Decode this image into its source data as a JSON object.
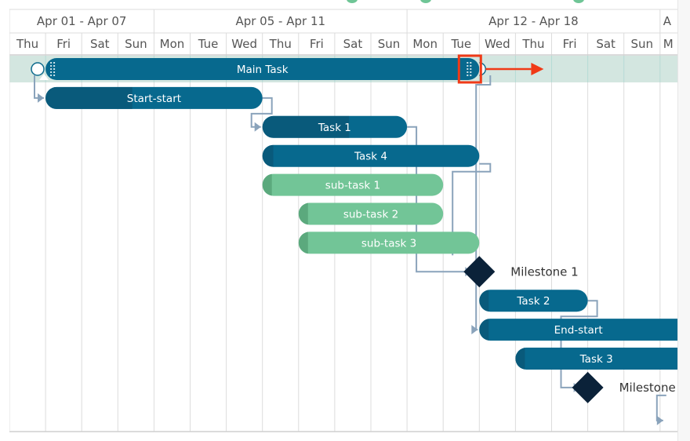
{
  "header": {
    "weeks": [
      "Apr 01 - Apr 07",
      "Apr 05 - Apr 11",
      "Apr 12 - Apr 18",
      "A"
    ],
    "days": [
      "Thu",
      "Fri",
      "Sat",
      "Sun",
      "Mon",
      "Tue",
      "Wed",
      "Thu",
      "Fri",
      "Sat",
      "Sun",
      "Mon",
      "Tue",
      "Wed",
      "Thu",
      "Fri",
      "Sat",
      "Sun",
      "M"
    ]
  },
  "tasks": [
    {
      "id": "main",
      "label": "Main Task",
      "start": 1,
      "end": 13,
      "row": 0,
      "type": "parent",
      "selected": true
    },
    {
      "id": "start-start",
      "label": "Start-start",
      "start": 1,
      "end": 7,
      "row": 1,
      "type": "task",
      "progress": 0.4
    },
    {
      "id": "task1",
      "label": "Task 1",
      "start": 7,
      "end": 11,
      "row": 2,
      "type": "task",
      "progress": 0.6
    },
    {
      "id": "task4",
      "label": "Task 4",
      "start": 7,
      "end": 13,
      "row": 3,
      "type": "task",
      "progress": 0.05
    },
    {
      "id": "subtask1",
      "label": "sub-task 1",
      "start": 7,
      "end": 12,
      "row": 4,
      "type": "subtask",
      "progress": 0.05
    },
    {
      "id": "subtask2",
      "label": "sub-task 2",
      "start": 8,
      "end": 12,
      "row": 5,
      "type": "subtask",
      "progress": 0.05
    },
    {
      "id": "subtask3",
      "label": "sub-task 3",
      "start": 8,
      "end": 13,
      "row": 6,
      "type": "subtask",
      "progress": 0.05
    },
    {
      "id": "milestone1",
      "label": "Milestone 1",
      "at": 13,
      "row": 7,
      "type": "milestone"
    },
    {
      "id": "task2",
      "label": "Task 2",
      "start": 13,
      "end": 16,
      "row": 8,
      "type": "task",
      "progress": 0.05
    },
    {
      "id": "end-start",
      "label": "End-start",
      "start": 13,
      "end": 19,
      "row": 9,
      "type": "task",
      "progress": 0.03
    },
    {
      "id": "task3",
      "label": "Task 3",
      "start": 14,
      "end": 19,
      "row": 10,
      "type": "task",
      "progress": 0.04
    },
    {
      "id": "milestone2",
      "label": "Milestone",
      "at": 16,
      "row": 11,
      "type": "milestone"
    }
  ],
  "colors": {
    "task": "#07698e",
    "task_progress": "#095a7b",
    "subtask": "#72c597",
    "subtask_progress": "#5ba97d",
    "milestone": "#0b2239",
    "link": "#8aa3bb",
    "selected_row": "#d3e6e0",
    "highlight": "#f03a17",
    "grid": "#dcdcdc"
  }
}
